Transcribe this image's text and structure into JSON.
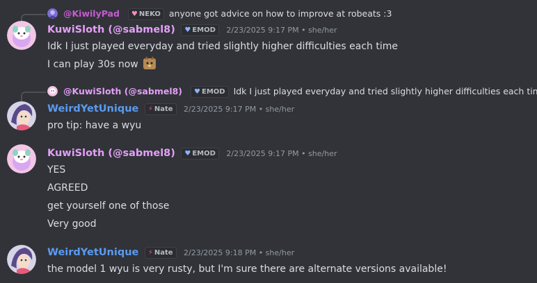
{
  "messages": [
    {
      "reply": {
        "username": "@KiwilyPad",
        "tag_icon": "heart-icon",
        "tag": "NEKO",
        "text": "anyone got advice on how to improve at robeats :3"
      },
      "author": "KuwiSloth (@sabmel8)",
      "tag": "EMOD",
      "tag_icon": "shield-heart-icon",
      "timestamp": "2/23/2025 9:17 PM • she/her",
      "lines": [
        "Idk I just played everyday and tried slightly higher difficulties each time",
        "I can play 30s now"
      ]
    },
    {
      "reply": {
        "username": "@KuwiSloth (@sabmel8)",
        "tag_icon": "shield-heart-icon",
        "tag": "EMOD",
        "text": "Idk I just played everyday and tried slightly higher difficulties each time"
      },
      "author": "WeirdYetUnique",
      "tag": "Nate",
      "tag_icon": "lightning-icon",
      "timestamp": "2/23/2025 9:17 PM • she/her",
      "lines": [
        "pro tip: have a wyu"
      ]
    },
    {
      "author": "KuwiSloth (@sabmel8)",
      "tag": "EMOD",
      "tag_icon": "shield-heart-icon",
      "timestamp": "2/23/2025 9:17 PM • she/her",
      "lines": [
        "YES",
        "AGREED",
        "get yourself one of those",
        "Very good"
      ]
    },
    {
      "author": "WeirdYetUnique",
      "tag": "Nate",
      "tag_icon": "lightning-icon",
      "timestamp": "2/23/2025 9:18 PM • she/her",
      "lines": [
        "the model 1 wyu is very rusty, but I'm sure there are alternate versions available!"
      ]
    }
  ],
  "colors": {
    "background": "#313338",
    "kuwisloth_name": "#e39ff6",
    "kiwilypad_name": "#c75bd3",
    "weirdyetunique_name": "#5a9bf0",
    "timestamp": "#949ba4",
    "text": "#dbdee1"
  }
}
